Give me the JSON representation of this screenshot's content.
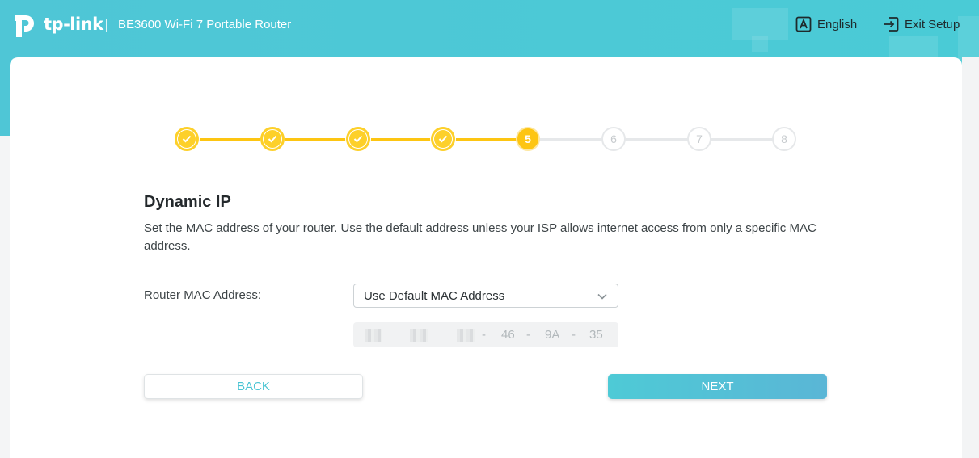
{
  "header": {
    "logo_text": "tp-link",
    "product_name": "BE3600 Wi-Fi 7 Portable Router",
    "language_label": "English",
    "exit_label": "Exit Setup"
  },
  "stepper": {
    "steps": [
      {
        "label": "",
        "state": "done"
      },
      {
        "label": "",
        "state": "done"
      },
      {
        "label": "",
        "state": "done"
      },
      {
        "label": "",
        "state": "done"
      },
      {
        "label": "5",
        "state": "current"
      },
      {
        "label": "6",
        "state": "todo"
      },
      {
        "label": "7",
        "state": "todo"
      },
      {
        "label": "8",
        "state": "todo"
      }
    ]
  },
  "main": {
    "title": "Dynamic IP",
    "description": "Set the MAC address of your router. Use the default address unless your ISP allows internet access from only a specific MAC address.",
    "mac_field_label": "Router MAC Address:",
    "mac_select_value": "Use Default MAC Address",
    "mac_visible": {
      "separator": "-",
      "oct4": "46",
      "oct5": "9A",
      "oct6": "35"
    }
  },
  "buttons": {
    "back_label": "BACK",
    "next_label": "NEXT"
  },
  "colors": {
    "accent": "#4ac4d3",
    "step_yellow": "#fdc512"
  }
}
